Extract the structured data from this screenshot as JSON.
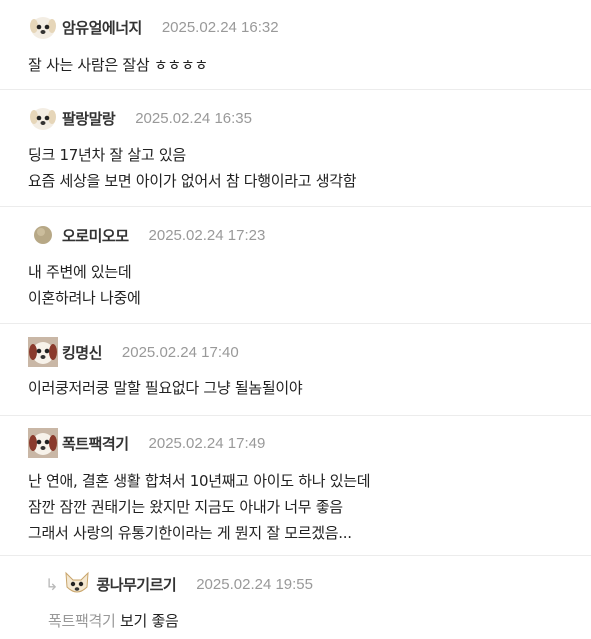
{
  "comments": [
    {
      "nick": "암유얼에너지",
      "date": "2025.02.24 16:32",
      "lines": [
        "잘 사는 사람은 잘삼 ㅎㅎㅎㅎ"
      ]
    },
    {
      "nick": "팔랑말랑",
      "date": "2025.02.24 16:35",
      "lines": [
        "딩크 17년차 잘 살고 있음",
        "요즘 세상을 보면 아이가 없어서 참 다행이라고 생각함"
      ]
    },
    {
      "nick": "오로미오모",
      "date": "2025.02.24 17:23",
      "lines": [
        "내 주변에 있는데",
        "이혼하려나 나중에"
      ]
    },
    {
      "nick": "킹명신",
      "date": "2025.02.24 17:40",
      "lines": [
        "이러쿵저러쿵 말할 필요없다 그냥 될놈될이야"
      ]
    },
    {
      "nick": "폭트팩격기",
      "date": "2025.02.24 17:49",
      "lines": [
        "난 연애, 결혼 생활 합쳐서 10년째고 아이도 하나 있는데",
        "잠깐 잠깐 권태기는 왔지만 지금도 아내가 너무 좋음",
        "그래서 사랑의 유통기한이라는 게 뭔지 잘 모르겠음..."
      ]
    }
  ],
  "reply": {
    "nick": "콩나무기르기",
    "date": "2025.02.24 19:55",
    "mention": "폭트팩격기",
    "text": "보기 좋음"
  },
  "icons": {
    "reply": "reply-arrow-icon",
    "avatar": "dog-avatar-icon"
  }
}
